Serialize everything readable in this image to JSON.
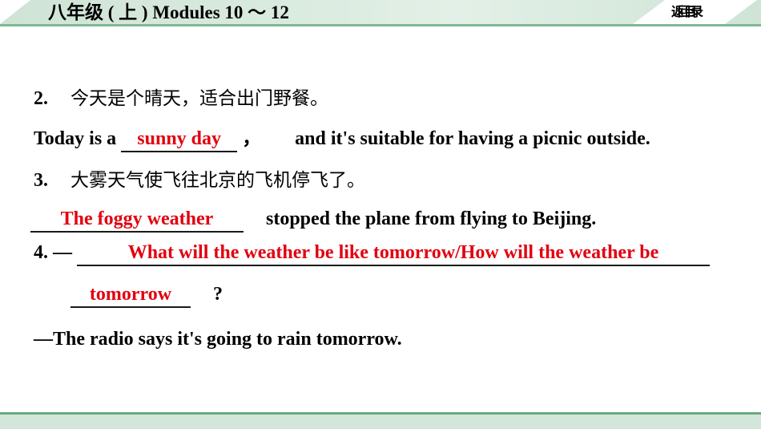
{
  "header": {
    "title": "八年级 ( 上 ) Modules 10 ～ 12",
    "back_button_label": "返回目录",
    "band_color": "#cfe4d6",
    "rule_color": "#7fb894"
  },
  "footer": {
    "rule_color": "#6aa880",
    "band_color": "#d4e6da"
  },
  "answer_color": "#e2000f",
  "exercises": [
    {
      "number": "2.",
      "chinese": "今天是个晴天，适合出门野餐。",
      "english_before": "Today is a",
      "answer": "sunny day",
      "english_mid": "，",
      "english_after": "and it's suitable for having a picnic outside."
    },
    {
      "number": "3.",
      "chinese": "大雾天气使飞往北京的飞机停飞了。",
      "answer": "The foggy weather",
      "english_after": "stopped the plane from flying to Beijing."
    },
    {
      "number": "4.",
      "dash": "—",
      "answer_line1": "What will the weather be like tomorrow/How will the weather be",
      "answer_line2": "tomorrow",
      "question_mark": "?",
      "reply": "—The radio says it's going to rain tomorrow."
    }
  ]
}
